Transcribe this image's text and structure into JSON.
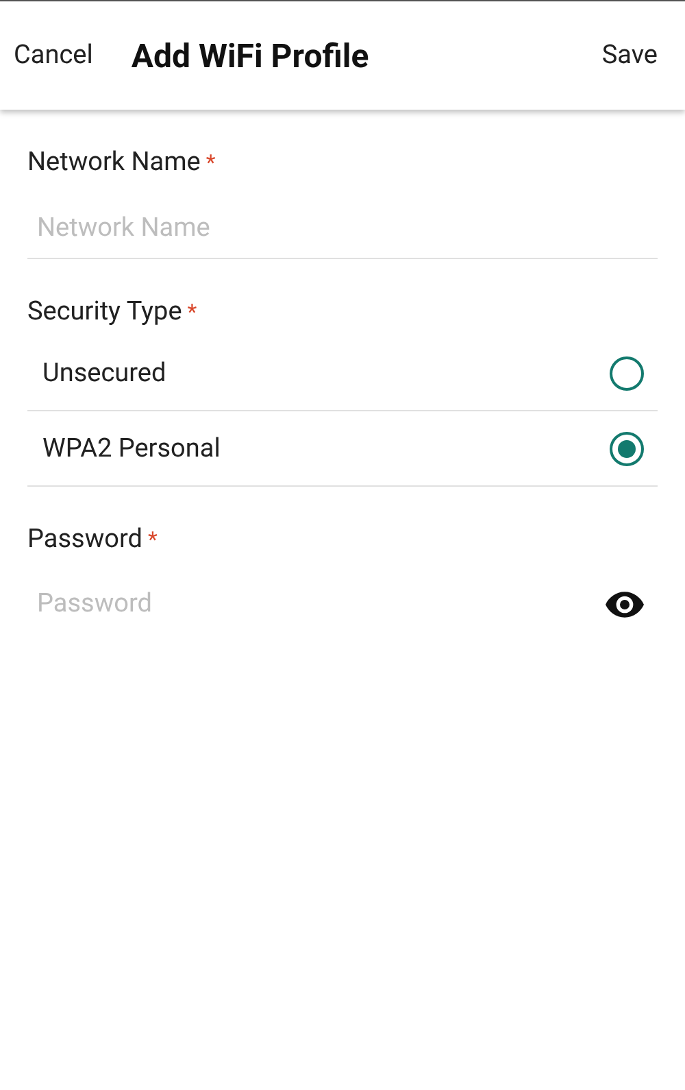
{
  "header": {
    "cancel": "Cancel",
    "title": "Add WiFi Profile",
    "save": "Save"
  },
  "network_name": {
    "label": "Network Name",
    "required_mark": "*",
    "placeholder": "Network Name"
  },
  "security_type": {
    "label": "Security Type",
    "required_mark": "*",
    "options": [
      {
        "label": "Unsecured",
        "selected": false
      },
      {
        "label": "WPA2 Personal",
        "selected": true
      }
    ]
  },
  "password": {
    "label": "Password",
    "required_mark": "*",
    "placeholder": "Password"
  }
}
